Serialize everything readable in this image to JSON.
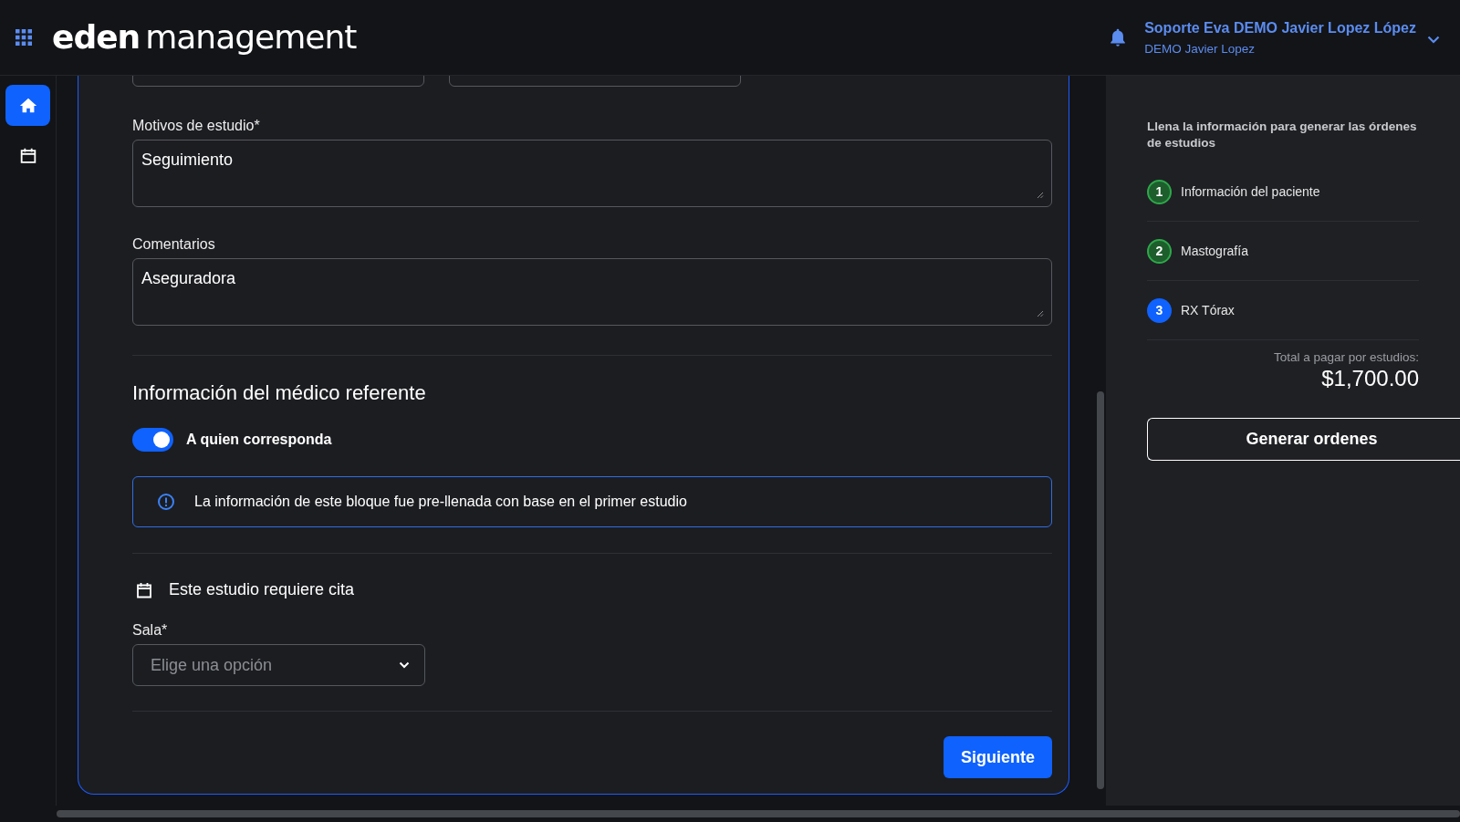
{
  "header": {
    "logo_bold": "eden",
    "logo_light": "management",
    "user_name": "Soporte Eva DEMO Javier Lopez López",
    "user_subtitle": "DEMO Javier Lopez"
  },
  "nav": [
    {
      "kind": "home",
      "selected": true
    },
    {
      "kind": "calendar",
      "selected": false
    }
  ],
  "form": {
    "fields": [
      {
        "label": "Motivos de estudio*",
        "value": "Seguimiento"
      },
      {
        "label": "Comentarios",
        "value": "Aseguradora"
      }
    ],
    "section_title": "Información del médico referente",
    "toggle": {
      "label": "A quien corresponda",
      "on": true
    },
    "notice": "La información de este bloque fue pre-llenada con base en el primer estudio",
    "appointment": "Este estudio requiere cita",
    "select": {
      "label": "Sala*",
      "placeholder": "Elige una opción"
    },
    "next_button": "Siguiente"
  },
  "summary": {
    "intro": "Llena la información para generar las órdenes de estudios",
    "steps": [
      {
        "number": "1",
        "label": "Información del paciente",
        "completed": true
      },
      {
        "number": "2",
        "label": "Mastografía",
        "completed": true
      },
      {
        "number": "3",
        "label": "RX Tórax",
        "completed": false
      }
    ],
    "total_label": "Total a pagar por estudios:",
    "total": "$1,700.00",
    "button": "Generar ordenes"
  }
}
